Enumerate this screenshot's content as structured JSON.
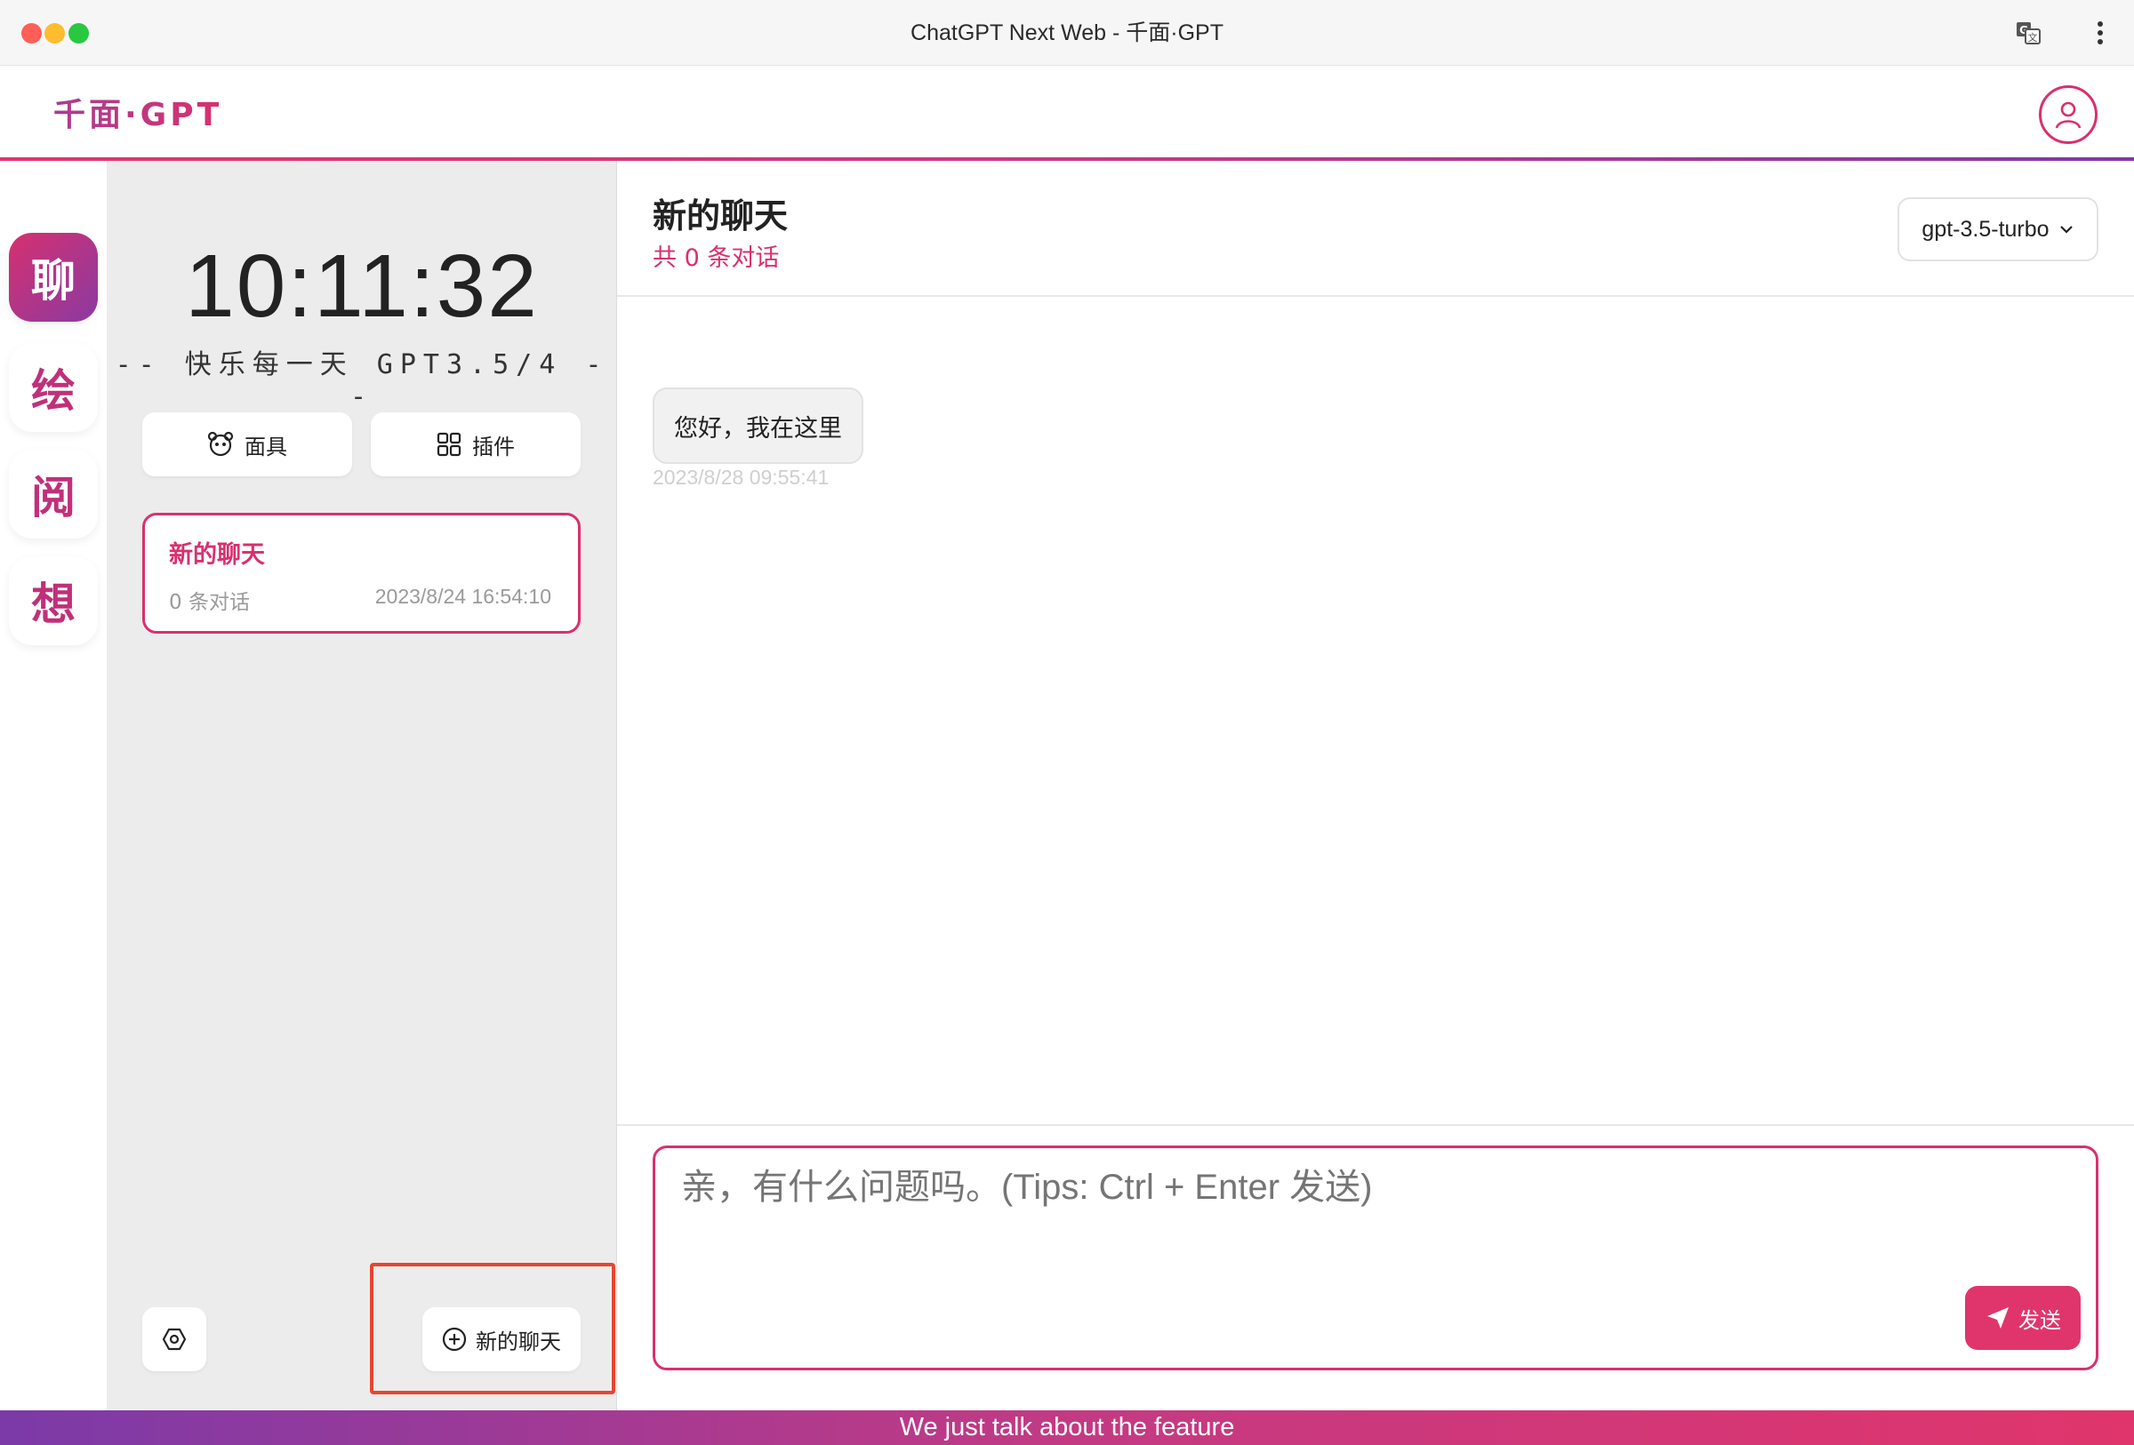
{
  "window": {
    "title": "ChatGPT Next Web - 千面·GPT"
  },
  "brand": {
    "name": "千面·GPT",
    "accent": "#d9306e",
    "accent_secondary": "#8b3aa2"
  },
  "rail": {
    "items": [
      "聊",
      "绘",
      "阅",
      "想"
    ],
    "active_index": 0
  },
  "sidebar": {
    "clock": "10:11:32",
    "tagline": "-- 快乐每一天 GPT3.5/4 --",
    "mask_label": "面具",
    "plugin_label": "插件",
    "chat_list": [
      {
        "title": "新的聊天",
        "count": "0 条对话",
        "time": "2023/8/24 16:54:10"
      }
    ],
    "new_chat_label": "新的聊天"
  },
  "chat": {
    "title": "新的聊天",
    "subtitle": "共 0 条对话",
    "model": "gpt-3.5-turbo",
    "messages": [
      {
        "text": "您好，我在这里",
        "time": "2023/8/28 09:55:41"
      }
    ],
    "input_placeholder": "亲，有什么问题吗。(Tips: Ctrl + Enter 发送)",
    "send_label": "发送"
  },
  "footer": {
    "text": "We just talk about the feature"
  }
}
